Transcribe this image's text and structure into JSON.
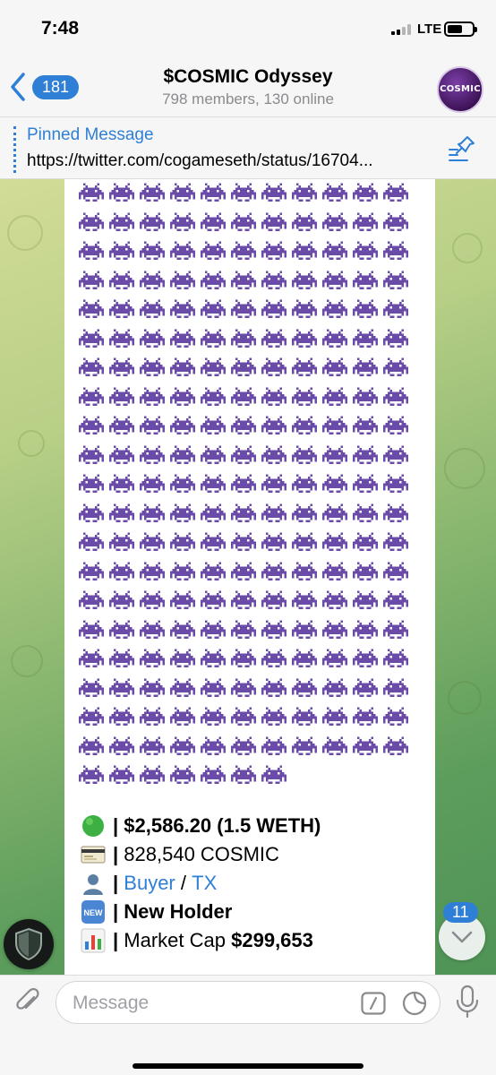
{
  "status_bar": {
    "time": "7:48",
    "network": "LTE",
    "battery_level": 0.62
  },
  "header": {
    "back_count": "181",
    "title": "$COSMIC Odyssey",
    "subtitle": "798 members, 130 online",
    "avatar_text": "COSMIC"
  },
  "pinned": {
    "title": "Pinned Message",
    "text": "https://twitter.com/cogameseth/status/16704..."
  },
  "message": {
    "emoji": "alien-monster-purple",
    "emoji_rows": [
      11,
      11,
      11,
      11,
      11,
      11,
      11,
      11,
      11,
      11,
      11,
      11,
      11,
      11,
      11,
      11,
      11,
      11,
      11,
      11,
      7
    ],
    "price_icon": "green-circle-icon",
    "price": "$2,586.20 (1.5 WETH)",
    "amount_icon": "credit-card-icon",
    "amount": "828,540 COSMIC",
    "buyer_icon": "person-silhouette-icon",
    "buyer_label": "Buyer",
    "separator": "/",
    "tx_label": "TX",
    "new_icon": "new-button-icon",
    "new_icon_text": "NEW",
    "holder_label": "New Holder",
    "mcap_icon": "bar-chart-icon",
    "mcap_label": "Market Cap",
    "mcap_value": "$299,653"
  },
  "scroll_down": {
    "badge": "11"
  },
  "composer": {
    "placeholder": "Message"
  },
  "colors": {
    "accent": "#2f7fd6",
    "invader": "#6b4ba8"
  }
}
